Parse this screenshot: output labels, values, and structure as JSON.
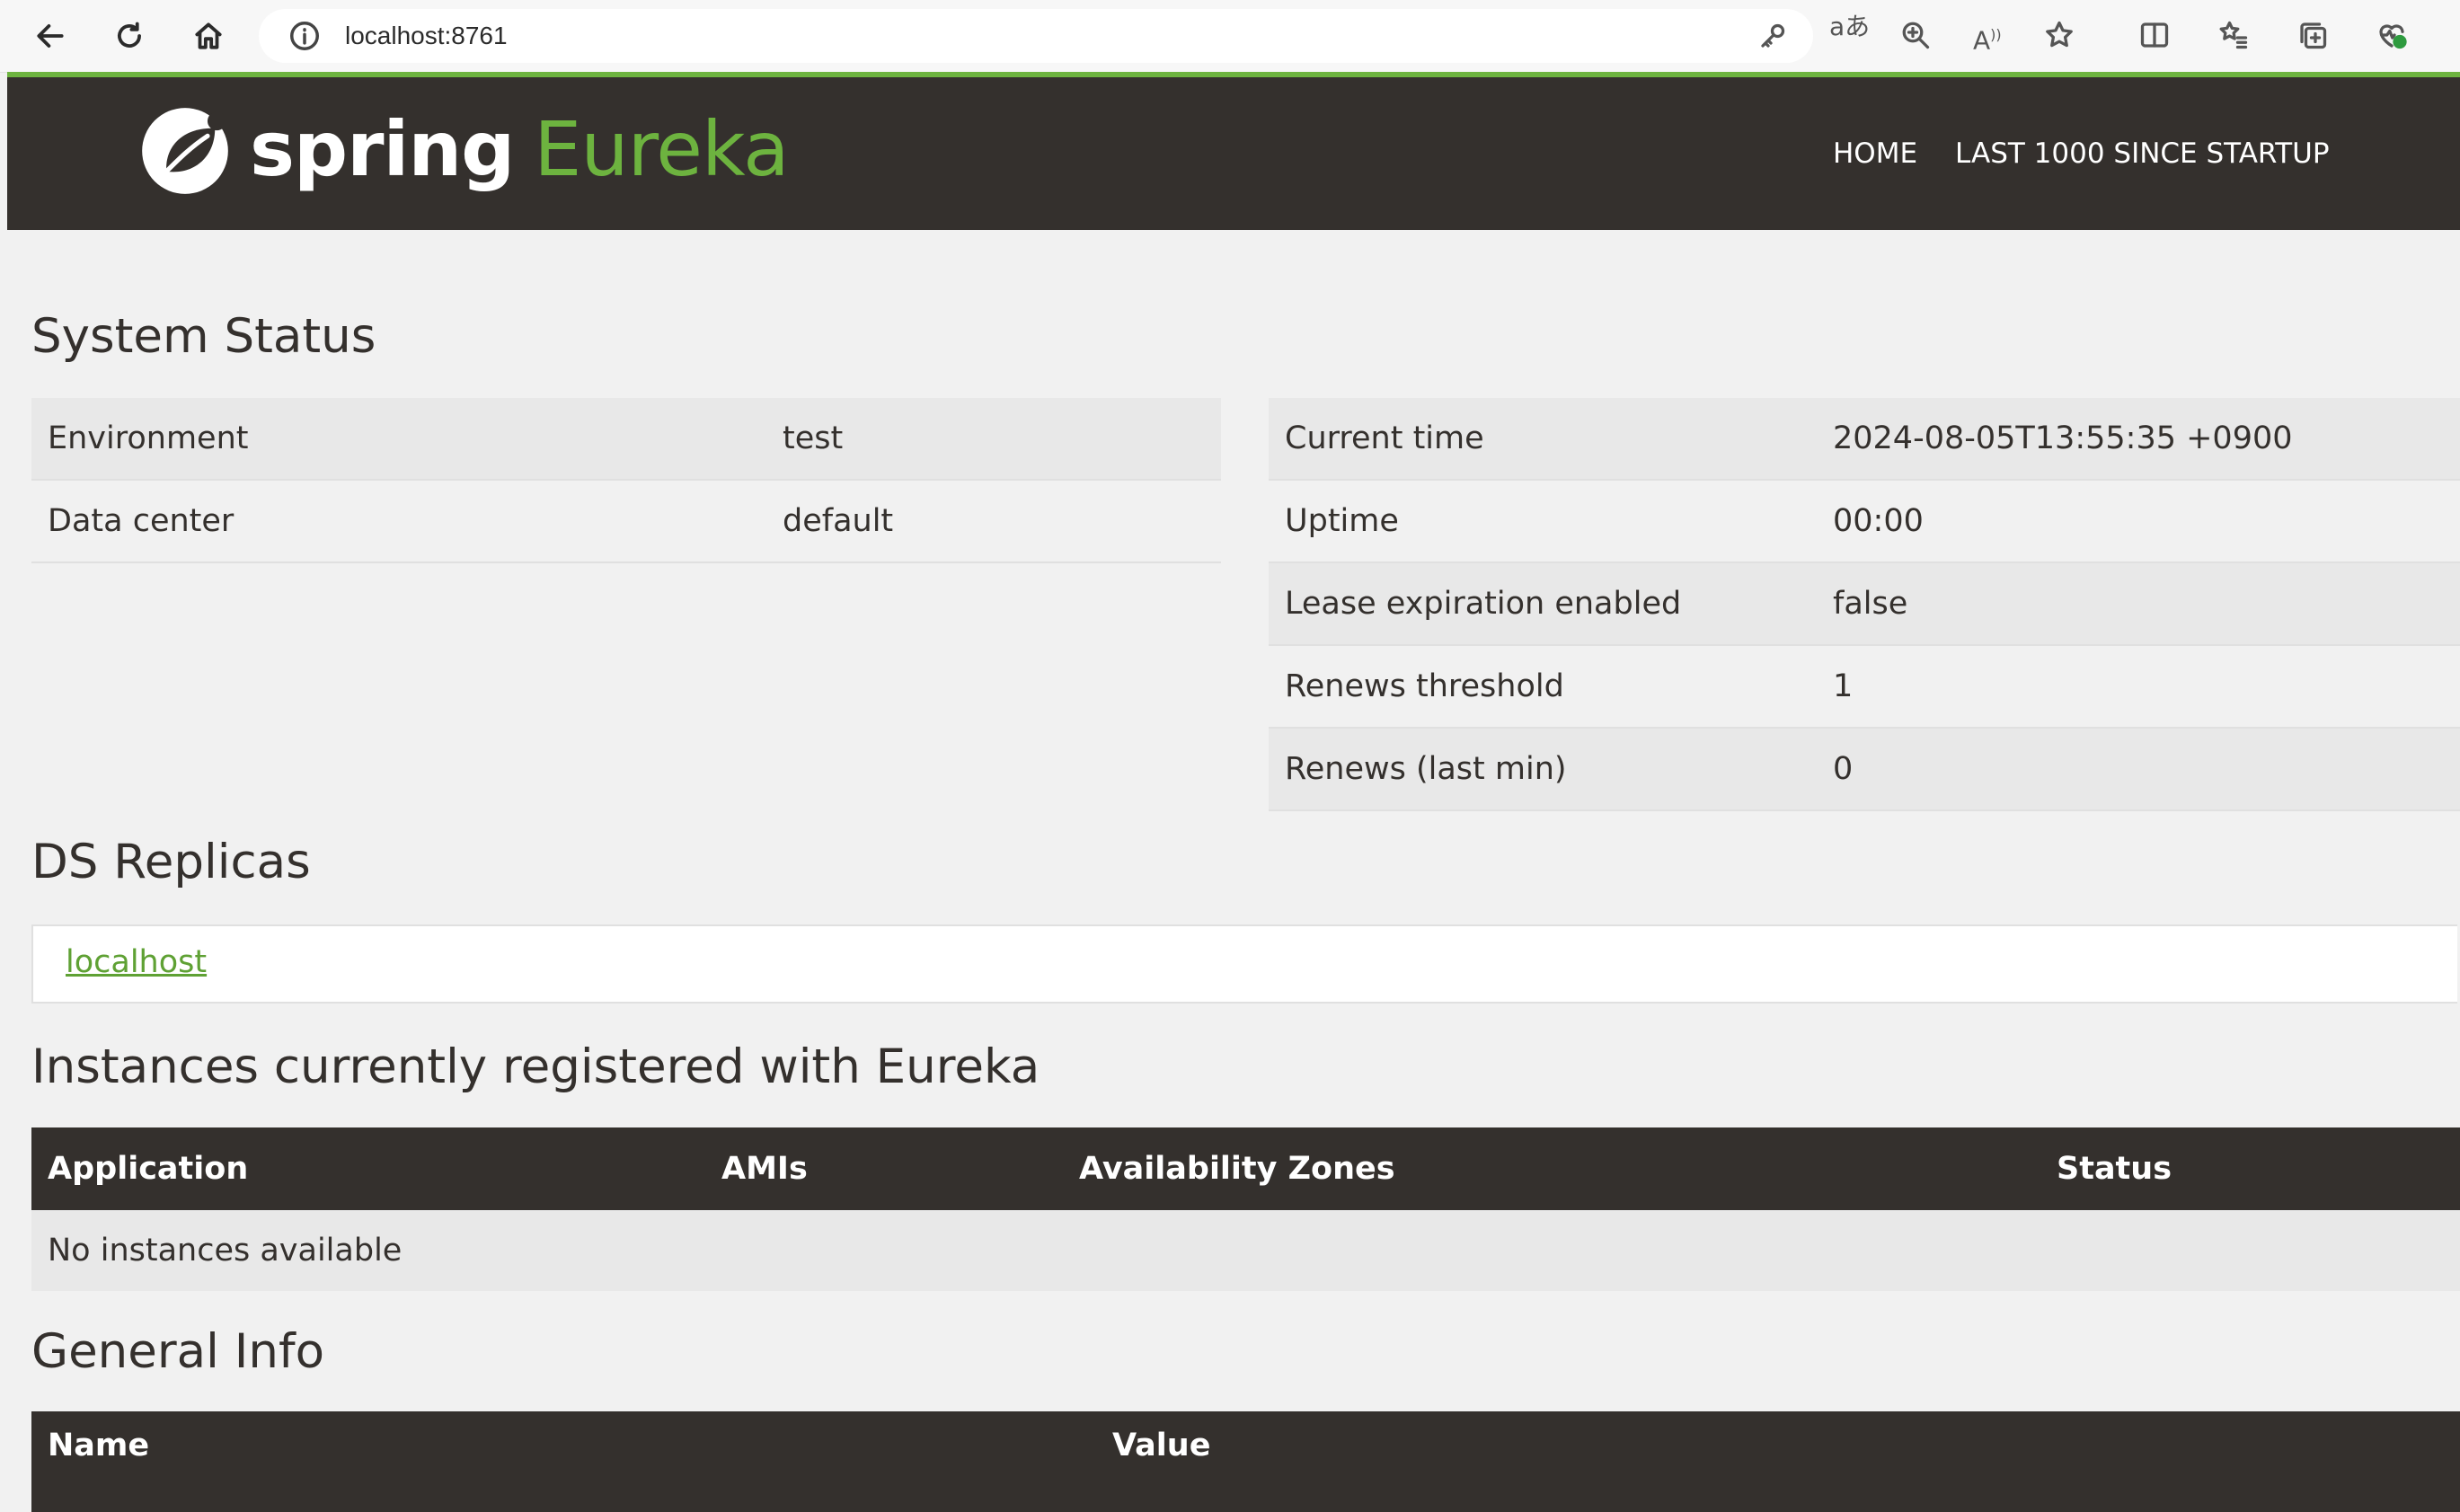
{
  "browser": {
    "url": "localhost:8761"
  },
  "header": {
    "logo_spring": "spring",
    "logo_eureka": "Eureka",
    "nav": [
      {
        "label": "HOME"
      },
      {
        "label": "LAST 1000 SINCE STARTUP"
      }
    ]
  },
  "system_status": {
    "title": "System Status",
    "left": [
      {
        "label": "Environment",
        "value": "test"
      },
      {
        "label": "Data center",
        "value": "default"
      }
    ],
    "right": [
      {
        "label": "Current time",
        "value": "2024-08-05T13:55:35 +0900"
      },
      {
        "label": "Uptime",
        "value": "00:00"
      },
      {
        "label": "Lease expiration enabled",
        "value": "false"
      },
      {
        "label": "Renews threshold",
        "value": "1"
      },
      {
        "label": "Renews (last min)",
        "value": "0"
      }
    ]
  },
  "ds_replicas": {
    "title": "DS Replicas",
    "link": "localhost"
  },
  "instances": {
    "title": "Instances currently registered with Eureka",
    "columns": [
      "Application",
      "AMIs",
      "Availability Zones",
      "Status"
    ],
    "empty_message": "No instances available"
  },
  "general_info": {
    "title": "General Info",
    "columns": [
      "Name",
      "Value"
    ]
  },
  "colors": {
    "brand_green": "#6db33f",
    "header_dark": "#34302d",
    "page_bg": "#f1f1f1"
  }
}
